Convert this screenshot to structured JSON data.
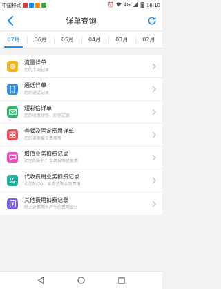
{
  "status_bar": {
    "carrier": "中国移动",
    "time": "16:10",
    "signal_text": "4G",
    "colors": {
      "badge1": "#e53935",
      "badge2": "#1e88e5",
      "badge3": "#fb8c00",
      "badge4": "#43a047"
    }
  },
  "header": {
    "title": "详单查询"
  },
  "tabs": [
    {
      "label": "07月",
      "active": true
    },
    {
      "label": "06月"
    },
    {
      "label": "05月"
    },
    {
      "label": "04月"
    },
    {
      "label": "03月"
    },
    {
      "label": "02月"
    }
  ],
  "items": [
    {
      "title": "流量详单",
      "subtitle": "您的上网记录",
      "icon": "globe-icon",
      "color": "#f6b21b"
    },
    {
      "title": "通话详单",
      "subtitle": "您的通话记录",
      "icon": "phone-icon",
      "color": "#2a8df0"
    },
    {
      "title": "短彩信详单",
      "subtitle": "您的收发短信、彩信记录",
      "icon": "envelope-icon",
      "color": "#2fb66b"
    },
    {
      "title": "套餐及固定费用详单",
      "subtitle": "您的各类套餐费用等",
      "icon": "grid-icon",
      "color": "#ef4c55"
    },
    {
      "title": "增值业务扣费记录",
      "subtitle": "如您的彩铃、手机报等信息费",
      "icon": "message-icon",
      "color": "#e250b7"
    },
    {
      "title": "代收费用业务扣费记录",
      "subtitle": "如您的QQ、爱奇艺等会员费用",
      "icon": "user-icon",
      "color": "#1bb0a0"
    },
    {
      "title": "其他费用扣费记录",
      "subtitle": "除上述费用外产生的费用合计",
      "icon": "money-icon",
      "color": "#7a5ce6"
    }
  ],
  "theme": {
    "accent": "#1f8ce6",
    "background": "#f2f2f2"
  }
}
